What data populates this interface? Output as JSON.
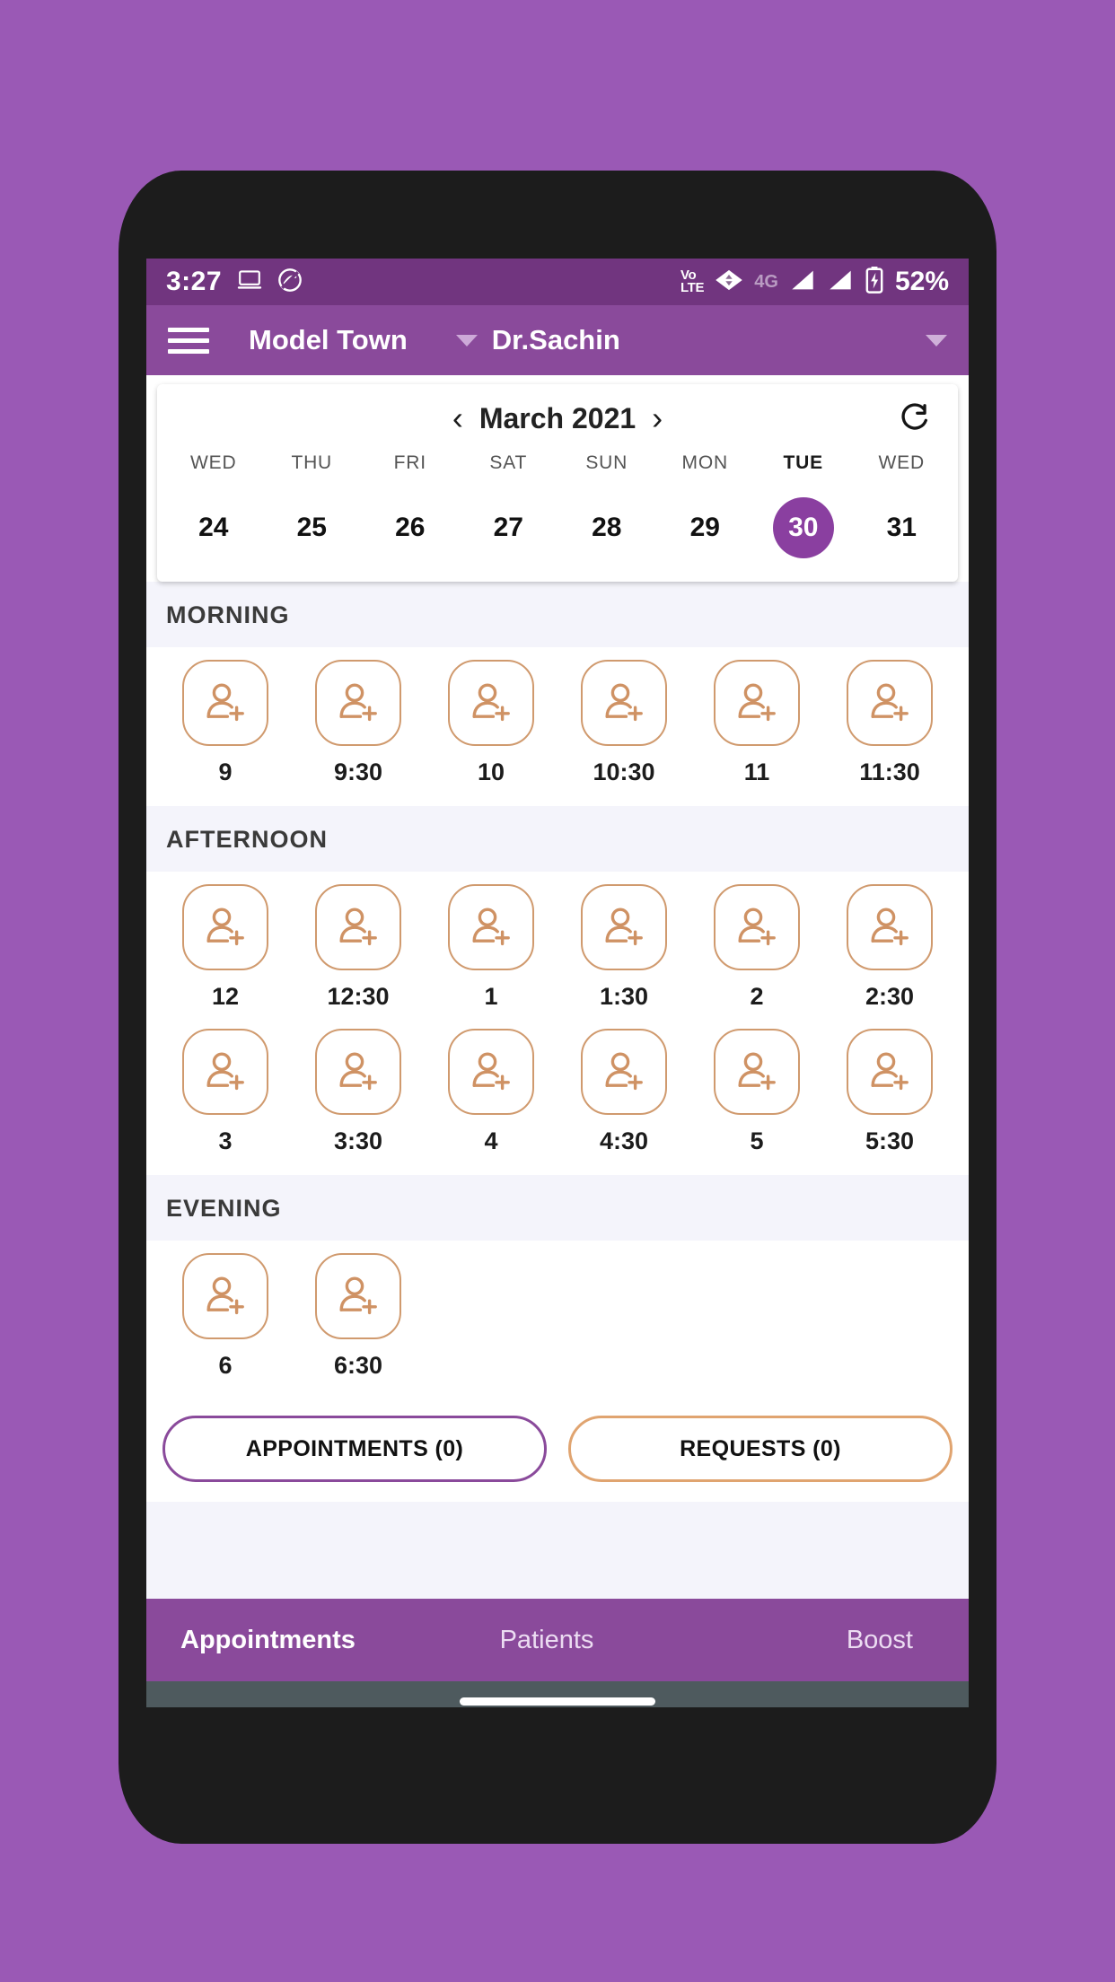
{
  "status_bar": {
    "time": "3:27",
    "icons_left": [
      "laptop-cast-icon",
      "do-not-disturb-icon"
    ],
    "network_label": "VoLTE",
    "network_line1": "Vo",
    "network_line2": "LTE",
    "data_label": "4G",
    "battery_percent": "52%",
    "background": "#71357f"
  },
  "app_bar": {
    "menu_icon": "hamburger-icon",
    "clinic": "Model Town",
    "doctor": "Dr.Sachin",
    "background": "#8a4a9b"
  },
  "calendar": {
    "prev_label": "‹",
    "next_label": "›",
    "month": "March 2021",
    "refresh_icon": "refresh-icon",
    "selected_day": "30",
    "accent": "#8a3fa0",
    "days": [
      {
        "dow": "WED",
        "num": "24",
        "selected": false
      },
      {
        "dow": "THU",
        "num": "25",
        "selected": false
      },
      {
        "dow": "FRI",
        "num": "26",
        "selected": false
      },
      {
        "dow": "SAT",
        "num": "27",
        "selected": false
      },
      {
        "dow": "SUN",
        "num": "28",
        "selected": false
      },
      {
        "dow": "MON",
        "num": "29",
        "selected": false
      },
      {
        "dow": "TUE",
        "num": "30",
        "selected": true
      },
      {
        "dow": "WED",
        "num": "31",
        "selected": false
      }
    ]
  },
  "slots": {
    "slot_icon": "add-person-icon",
    "slot_border_color": "#d09a6e",
    "sections": [
      {
        "title": "MORNING",
        "rows": [
          [
            "9",
            "9:30",
            "10",
            "10:30",
            "11",
            "11:30"
          ]
        ]
      },
      {
        "title": "AFTERNOON",
        "rows": [
          [
            "12",
            "12:30",
            "1",
            "1:30",
            "2",
            "2:30"
          ],
          [
            "3",
            "3:30",
            "4",
            "4:30",
            "5",
            "5:30"
          ]
        ]
      },
      {
        "title": "EVENING",
        "rows": [
          [
            "6",
            "6:30"
          ]
        ]
      }
    ]
  },
  "actions": {
    "appointments": "APPOINTMENTS (0)",
    "appointments_color": "#8a4a9b",
    "requests": "REQUESTS (0)",
    "requests_color": "#e0a470"
  },
  "bottom_nav": {
    "items": [
      {
        "label": "Appointments",
        "active": true
      },
      {
        "label": "Patients",
        "active": false
      },
      {
        "label": "Boost",
        "active": false
      }
    ]
  }
}
